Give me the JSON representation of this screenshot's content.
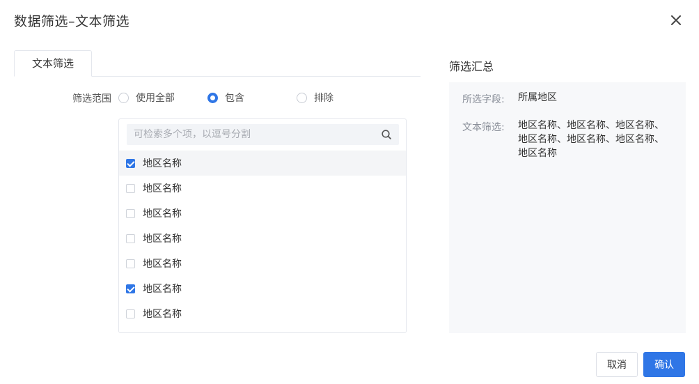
{
  "dialog": {
    "title": "数据筛选–文本筛选"
  },
  "tabs": [
    {
      "label": "文本筛选",
      "active": true
    }
  ],
  "range": {
    "label": "筛选范围",
    "options": [
      {
        "label": "使用全部",
        "checked": false
      },
      {
        "label": "包含",
        "checked": true
      },
      {
        "label": "排除",
        "checked": false
      }
    ]
  },
  "search": {
    "placeholder": "可检索多个项，以逗号分割",
    "value": ""
  },
  "items": [
    {
      "label": "地区名称",
      "checked": true
    },
    {
      "label": "地区名称",
      "checked": false
    },
    {
      "label": "地区名称",
      "checked": false
    },
    {
      "label": "地区名称",
      "checked": false
    },
    {
      "label": "地区名称",
      "checked": false
    },
    {
      "label": "地区名称",
      "checked": true
    },
    {
      "label": "地区名称",
      "checked": false
    }
  ],
  "summary": {
    "title": "筛选汇总",
    "field_label": "所选字段:",
    "field_value": "所属地区",
    "text_label": "文本筛选:",
    "text_value": "地区名称、地区名称、地区名称、地区名称、地区名称、地区名称、地区名称"
  },
  "footer": {
    "cancel_label": "取消",
    "confirm_label": "确认"
  },
  "colors": {
    "accent": "#2f76e6",
    "summary_bg": "#f7f8fa",
    "border": "#e4e7ed"
  }
}
